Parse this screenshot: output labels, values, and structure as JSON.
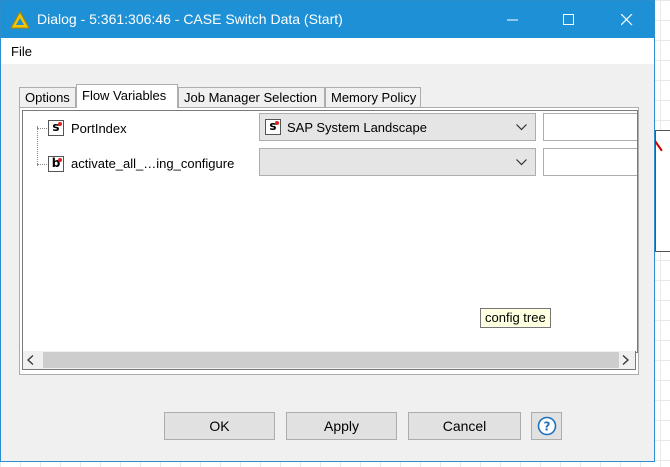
{
  "window": {
    "title": "Dialog - 5:361:306:46 - CASE Switch Data (Start)",
    "accent_color": "#1e90d6",
    "icons": {
      "app": "knime-triangle-icon",
      "minimize": "minimize-icon",
      "maximize": "maximize-icon",
      "close": "close-icon"
    }
  },
  "menu": {
    "file_label": "File"
  },
  "tabs": [
    {
      "label": "Options",
      "active": false
    },
    {
      "label": "Flow Variables",
      "active": true
    },
    {
      "label": "Job Manager Selection",
      "active": false
    },
    {
      "label": "Memory Policy",
      "active": false
    }
  ],
  "flow_variables": [
    {
      "type_glyph": "s",
      "name": "PortIndex",
      "selected_glyph": "s",
      "selected_value": "SAP System Landscape",
      "override_value": ""
    },
    {
      "type_glyph": "b",
      "name": "activate_all_…ing_configure",
      "selected_glyph": "",
      "selected_value": "",
      "override_value": ""
    }
  ],
  "tooltip": {
    "text": "config tree"
  },
  "buttons": {
    "ok": "OK",
    "apply": "Apply",
    "cancel": "Cancel",
    "help_icon": "help-icon"
  }
}
